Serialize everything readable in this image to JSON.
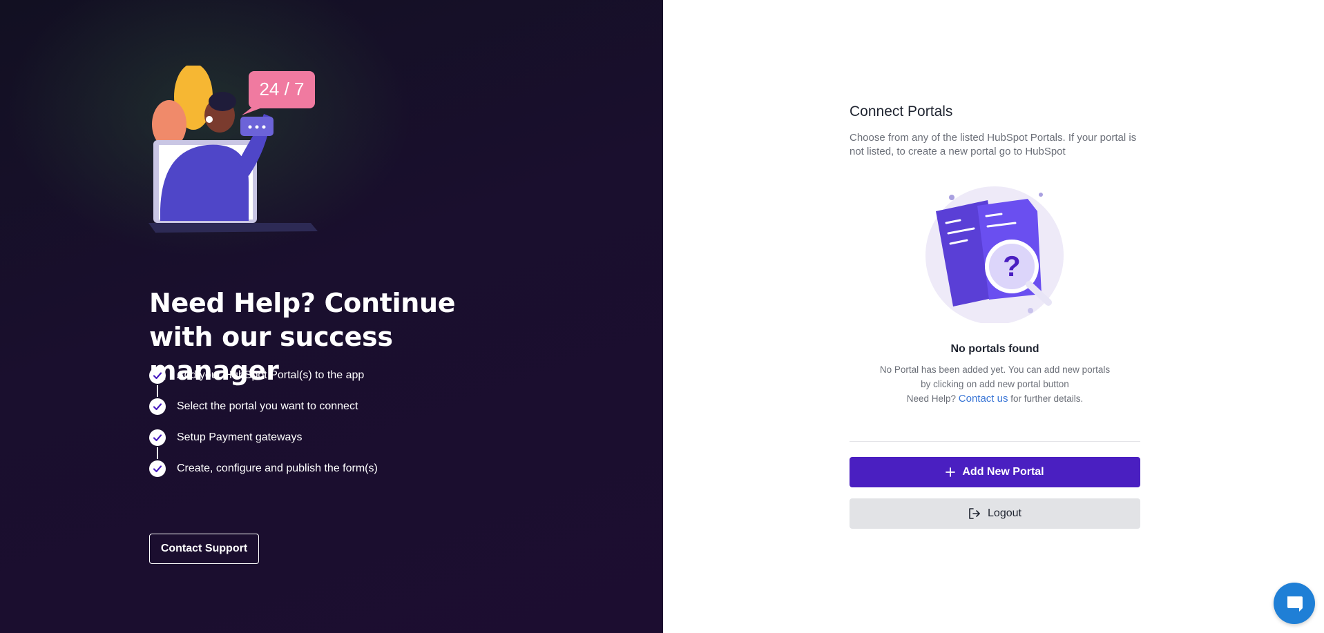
{
  "left_panel": {
    "heading": "Need Help? Continue with our success manager",
    "badge_text": "24 / 7",
    "steps": [
      "Add your HubSpot Portal(s) to the app",
      "Select the portal you want to connect",
      "Setup Payment gateways",
      "Create, configure and publish the form(s)"
    ],
    "contact_support_label": "Contact Support"
  },
  "right_panel": {
    "title": "Connect Portals",
    "description": "Choose from any of the listed HubSpot Portals. If your portal is not listed, to create a new portal go to HubSpot",
    "empty_state": {
      "title": "No portals found",
      "line1": "No Portal has been added yet. You can add new portals",
      "line2": "by clicking on add new portal button",
      "help_prefix": "Need Help?",
      "help_link": "Contact us",
      "help_suffix": "for further details."
    },
    "add_portal_label": "Add New Portal",
    "logout_label": "Logout"
  },
  "icons": {
    "check": "check-icon",
    "plus": "plus-icon",
    "logout": "logout-icon",
    "chat": "chat-icon"
  },
  "colors": {
    "primary": "#4a1fc1",
    "left_bg": "#1a0f2e",
    "link": "#3a76d6",
    "chat": "#1f7fd6"
  }
}
